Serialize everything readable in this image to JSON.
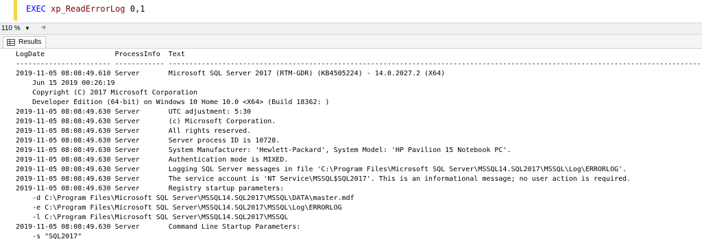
{
  "editor": {
    "keyword": "EXEC",
    "procedure": "xp_ReadErrorLog",
    "args": "0,1"
  },
  "statusbar": {
    "zoom": "110 %"
  },
  "tabs": [
    {
      "label": "Results"
    }
  ],
  "results": {
    "header": "LogDate                 ProcessInfo  Text",
    "separator": "----------------------- ------------ --------------------------------------------------------------------------------------------------------------------------------------------------------------------------------",
    "rows": [
      "2019-11-05 08:08:49.610 Server       Microsoft SQL Server 2017 (RTM-GDR) (KB4505224) - 14.0.2027.2 (X64)",
      "    Jun 15 2019 00:26:19",
      "    Copyright (C) 2017 Microsoft Corporation",
      "    Developer Edition (64-bit) on Windows 10 Home 10.0 <X64> (Build 18362: )",
      "2019-11-05 08:08:49.630 Server       UTC adjustment: 5:30",
      "2019-11-05 08:08:49.630 Server       (c) Microsoft Corporation.",
      "2019-11-05 08:08:49.630 Server       All rights reserved.",
      "2019-11-05 08:08:49.630 Server       Server process ID is 10728.",
      "2019-11-05 08:08:49.630 Server       System Manufacturer: 'Hewlett-Packard', System Model: 'HP Pavilion 15 Notebook PC'.",
      "2019-11-05 08:08:49.630 Server       Authentication mode is MIXED.",
      "2019-11-05 08:08:49.630 Server       Logging SQL Server messages in file 'C:\\Program Files\\Microsoft SQL Server\\MSSQL14.SQL2017\\MSSQL\\Log\\ERRORLOG'.",
      "2019-11-05 08:08:49.630 Server       The service account is 'NT Service\\MSSQL$SQL2017'. This is an informational message; no user action is required.",
      "2019-11-05 08:08:49.630 Server       Registry startup parameters:",
      "    -d C:\\Program Files\\Microsoft SQL Server\\MSSQL14.SQL2017\\MSSQL\\DATA\\master.mdf",
      "    -e C:\\Program Files\\Microsoft SQL Server\\MSSQL14.SQL2017\\MSSQL\\Log\\ERRORLOG",
      "    -l C:\\Program Files\\Microsoft SQL Server\\MSSQL14.SQL2017\\MSSQL",
      "2019-11-05 08:08:49.630 Server       Command Line Startup Parameters:",
      "    -s \"SQL2017\""
    ]
  },
  "colors": {
    "keyword": "#0000ff",
    "identifier": "#800000",
    "gutter_marker": "#f2d64d"
  },
  "icons": {
    "results_tab": "grid-icon",
    "zoom_dropdown": "chevron-down-icon",
    "scroll_left": "chevron-left-icon"
  }
}
